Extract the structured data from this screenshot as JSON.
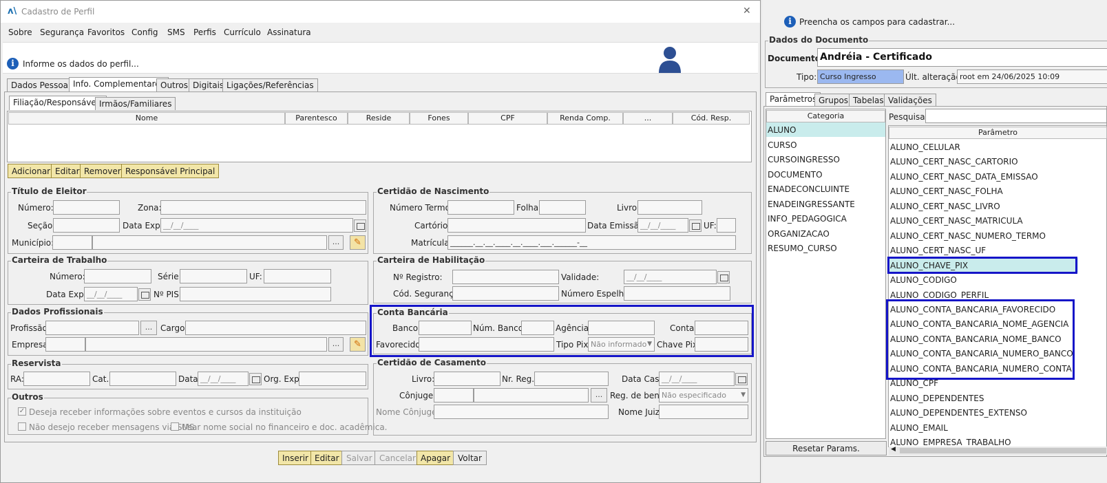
{
  "window": {
    "title": "Cadastro de Perfil",
    "close": "✕"
  },
  "menu": [
    "Sobre",
    "Segurança",
    "Favoritos",
    "Config",
    "SMS",
    "Perfis",
    "Currículo",
    "Assinatura"
  ],
  "banner": {
    "text": "Informe os dados do perfil..."
  },
  "tabs": [
    "Dados Pessoais",
    "Info. Complementares",
    "Outros",
    "Digitais",
    "Ligações/Referências"
  ],
  "subtabs": [
    "Filiação/Responsáveis",
    "Irmãos/Familiares"
  ],
  "table_headers": [
    "Nome",
    "Parentesco",
    "Reside",
    "Fones",
    "CPF",
    "Renda Comp.",
    "...",
    "Cód. Resp."
  ],
  "table_buttons": [
    "Adicionar",
    "Editar",
    "Remover",
    "Responsável Principal"
  ],
  "titulo_eleitor": {
    "title": "Título de Eleitor",
    "numero": "Número:",
    "zona": "Zona:",
    "secao": "Seção:",
    "data_exp": "Data Exp.:",
    "data_exp_val": "__/__/____",
    "municipio": "Município:"
  },
  "carteira_trabalho": {
    "title": "Carteira de Trabalho",
    "numero": "Número:",
    "serie": "Série:",
    "uf": "UF:",
    "data_exp": "Data Exp.:",
    "data_exp_val": "__/__/____",
    "pis": "Nº PIS:"
  },
  "dados_profissionais": {
    "title": "Dados Profissionais",
    "profissao": "Profissão:",
    "cargo": "Cargo:",
    "empresa": "Empresa:"
  },
  "reservista": {
    "title": "Reservista",
    "ra": "RA:",
    "cat": "Cat.:",
    "data": "Data:",
    "data_val": "__/__/____",
    "org": "Org. Exp.:"
  },
  "outros": {
    "title": "Outros",
    "chk1": "Deseja receber informações sobre eventos e cursos da instituição",
    "chk2": "Não desejo receber mensagens via SMS",
    "chk3": "Usar nome social no financeiro e doc. acadêmica."
  },
  "certidao_nascimento": {
    "title": "Certidão de Nascimento",
    "numero_termo": "Número Termo:",
    "folha": "Folha:",
    "livro": "Livro:",
    "cartorio": "Cartório:",
    "data_emissao": "Data Emissão:",
    "data_emissao_val": "__/__/____",
    "uf": "UF:",
    "matricula": "Matrícula:",
    "matricula_val": "______.__.__.____.__.____.___.______-__"
  },
  "carteira_habilitacao": {
    "title": "Carteira de Habilitação",
    "registro": "Nº Registro:",
    "validade": "Validade:",
    "validade_val": "__/__/____",
    "cod_seg": "Cód. Segurança:",
    "espelho": "Número Espelho:"
  },
  "conta_bancaria": {
    "title": "Conta Bancária",
    "banco": "Banco:",
    "num_banco": "Núm. Banco:",
    "agencia": "Agência:",
    "conta": "Conta:",
    "favorecido": "Favorecido:",
    "tipo_pix": "Tipo Pix:",
    "tipo_pix_val": "Não informado",
    "chave_pix": "Chave Pix:"
  },
  "certidao_casamento": {
    "title": "Certidão de Casamento",
    "livro": "Livro:",
    "nr_reg": "Nr. Reg.:",
    "data_cas": "Data Cas.:",
    "data_cas_val": "__/__/____",
    "conjuge": "Cônjuge:",
    "reg_bens": "Reg. de bens:",
    "reg_bens_val": "Não especificado",
    "nome_conjuge": "Nome Cônjuge:",
    "nome_juiz": "Nome Juiz:"
  },
  "bottom_buttons": [
    "Inserir",
    "Editar",
    "Salvar",
    "Cancelar",
    "Apagar",
    "Voltar"
  ],
  "right": {
    "hint": "Preencha os campos para cadastrar...",
    "group_title": "Dados do Documento",
    "documento_label": "Documento:",
    "documento_val": "Andréia - Certificado",
    "tipo_label": "Tipo:",
    "tipo_val": "Curso Ingresso",
    "ult_label": "Últ. alteração:",
    "ult_val": "root em 24/06/2025 10:09",
    "tabs": [
      "Parâmetros",
      "Grupos",
      "Tabelas",
      "Validações"
    ],
    "categoria_header": "Categoria",
    "categorias": [
      "ALUNO",
      "CURSO",
      "CURSOINGRESSO",
      "DOCUMENTO",
      "ENADECONCLUINTE",
      "ENADEINGRESSANTE",
      "INFO_PEDAGOGICA",
      "ORGANIZACAO",
      "RESUMO_CURSO"
    ],
    "pesquisar": "Pesquisar:",
    "parametro_header": "Parâmetro",
    "parametros": [
      "ALUNO_CELULAR",
      "ALUNO_CERT_NASC_CARTORIO",
      "ALUNO_CERT_NASC_DATA_EMISSAO",
      "ALUNO_CERT_NASC_FOLHA",
      "ALUNO_CERT_NASC_LIVRO",
      "ALUNO_CERT_NASC_MATRICULA",
      "ALUNO_CERT_NASC_NUMERO_TERMO",
      "ALUNO_CERT_NASC_UF",
      "ALUNO_CHAVE_PIX",
      "ALUNO_CODIGO",
      "ALUNO_CODIGO_PERFIL",
      "ALUNO_CONTA_BANCARIA_FAVORECIDO",
      "ALUNO_CONTA_BANCARIA_NOME_AGENCIA",
      "ALUNO_CONTA_BANCARIA_NOME_BANCO",
      "ALUNO_CONTA_BANCARIA_NUMERO_BANCO",
      "ALUNO_CONTA_BANCARIA_NUMERO_CONTA",
      "ALUNO_CPF",
      "ALUNO_DEPENDENTES",
      "ALUNO_DEPENDENTES_EXTENSO",
      "ALUNO_EMAIL",
      "ALUNO_EMPRESA_TRABALHO"
    ],
    "reset": "Resetar Params."
  }
}
